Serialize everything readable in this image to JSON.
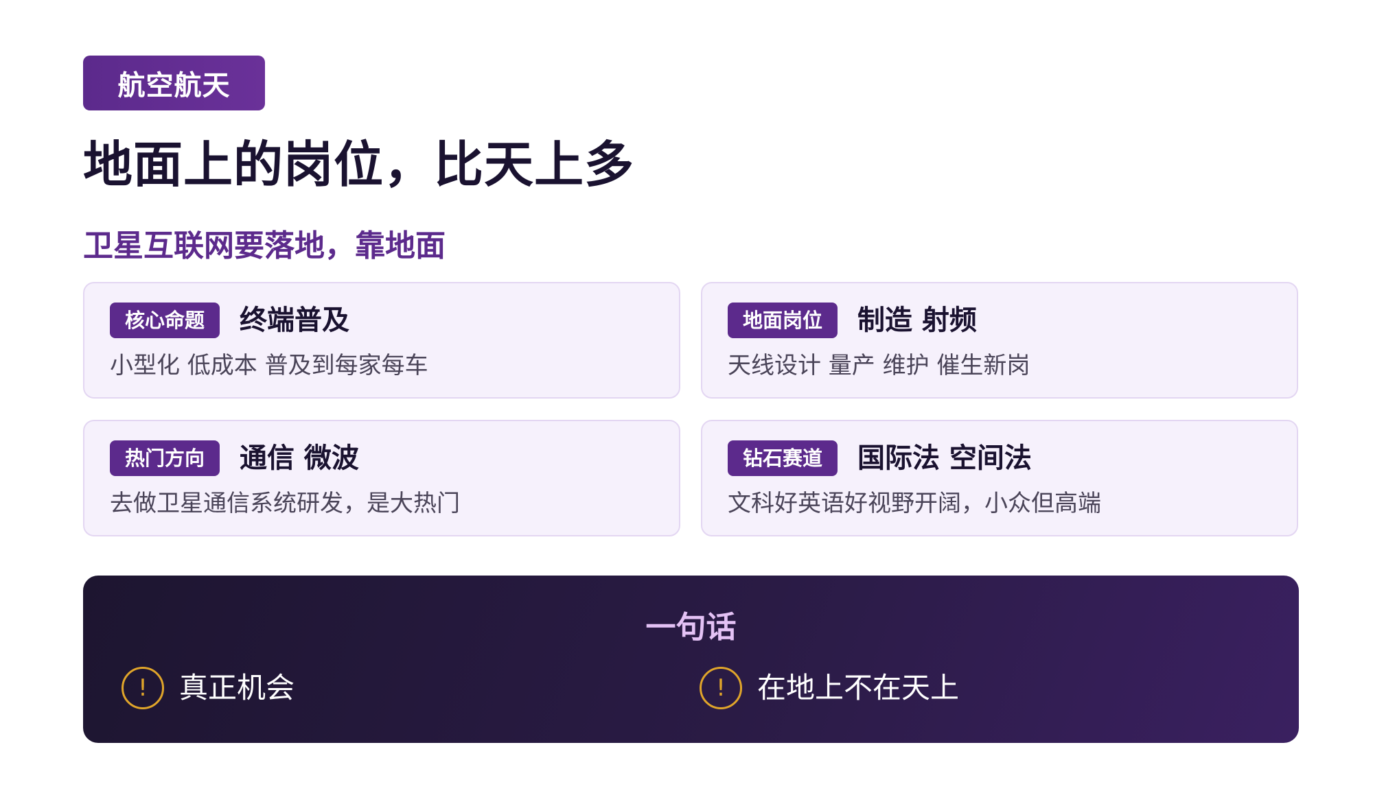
{
  "header": {
    "category": "航空航天",
    "title": "地面上的岗位，比天上多",
    "subtitle": "卫星互联网要落地，靠地面"
  },
  "cards": [
    {
      "tag": "核心命题",
      "heading": "终端普及",
      "description": "小型化 低成本 普及到每家每车"
    },
    {
      "tag": "地面岗位",
      "heading": "制造 射频",
      "description": "天线设计 量产 维护 催生新岗"
    },
    {
      "tag": "热门方向",
      "heading": "通信 微波",
      "description": "去做卫星通信系统研发，是大热门"
    },
    {
      "tag": "钻石赛道",
      "heading": "国际法 空间法",
      "description": "文科好英语好视野开阔，小众但高端"
    }
  ],
  "summary": {
    "title": "一句话",
    "points": [
      {
        "icon": "exclamation-circle-icon",
        "glyph": "!",
        "text": "真正机会"
      },
      {
        "icon": "exclamation-circle-icon",
        "glyph": "!",
        "text": "在地上不在天上"
      }
    ]
  },
  "colors": {
    "accent": "#5c2a8c",
    "card_bg": "#f6f1fc",
    "card_border": "#e3d6f2",
    "panel_dark": "#1d1530",
    "summary_title": "#e4c2f5",
    "alert": "#e0a52a"
  }
}
